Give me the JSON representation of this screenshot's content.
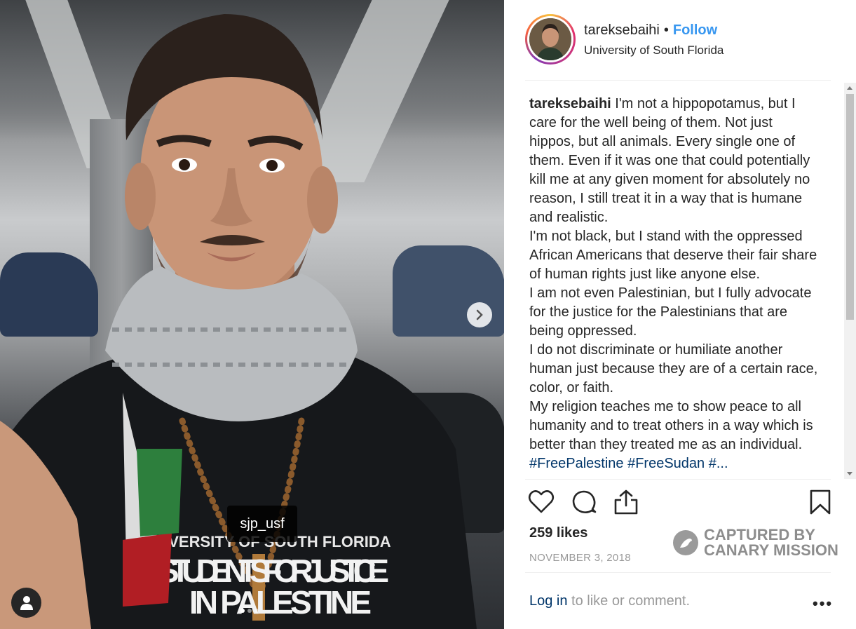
{
  "post": {
    "photo": {
      "tag_label": "sjp_usf",
      "shirt_text_line1": "UNIVERSITY OF SOUTH FLORIDA",
      "shirt_text_line2": "STUDENTS FOR JUSTICE",
      "shirt_text_line3": "IN PALESTINE",
      "carousel_count": 3,
      "carousel_active": 1
    },
    "header": {
      "username": "tareksebaihi",
      "separator": "•",
      "follow_label": "Follow",
      "location": "University of South Florida"
    },
    "caption": {
      "username": "tareksebaihi",
      "paragraphs": [
        "I'm not a hippopotamus, but I care for the well being of them. Not just hippos, but all animals. Every single one of them. Even if it was one that could potentially kill me at any given moment for absolutely no reason, I still treat it in a way that is humane and realistic.",
        "I'm not black, but I stand with the oppressed African Americans that deserve their fair share of human rights just like anyone else.",
        "I am not even Palestinian, but I fully advocate for the justice for the Palestinians that are being oppressed.",
        "I do not discriminate or humiliate another human just because they are of a certain race, color, or faith.",
        "My religion teaches me to show peace to all humanity and to treat others in a way which is better than they treated me as an individual."
      ],
      "hashtags": "#FreePalestine #FreeSudan #..."
    },
    "stats": {
      "likes": "259 likes",
      "date": "NOVEMBER 3, 2018"
    },
    "watermark": {
      "line1": "CAPTURED BY",
      "line2": "CANARY MISSION"
    },
    "footer": {
      "login_link": "Log in",
      "login_rest": " to like or comment.",
      "more": "•••"
    },
    "icons": [
      "heart-icon",
      "comment-icon",
      "share-icon",
      "bookmark-icon",
      "chevron-right-icon",
      "user-icon",
      "bird-icon"
    ]
  }
}
